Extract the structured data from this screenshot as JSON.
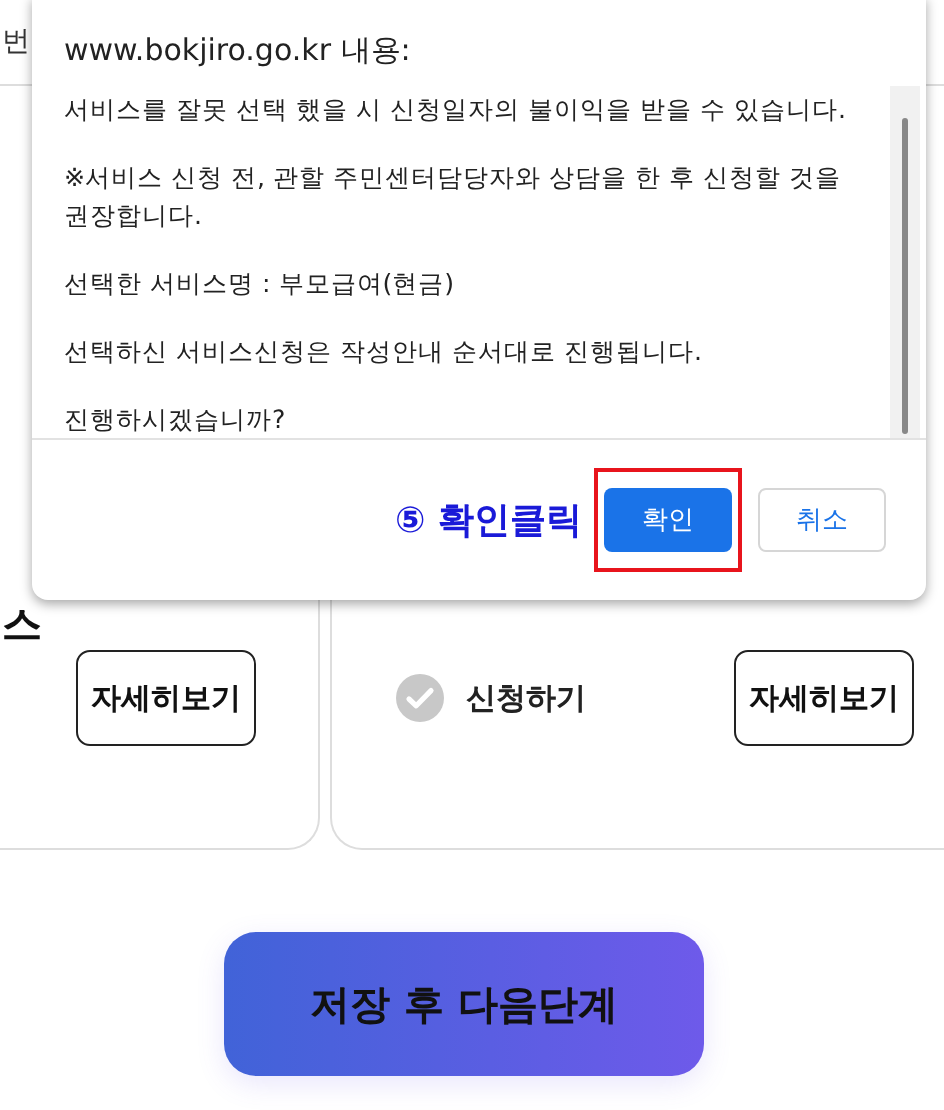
{
  "page_header": {
    "text": "번"
  },
  "cards": [
    {
      "title_fragment": "스",
      "detail_button": "자세히보기"
    },
    {
      "apply": {
        "label": "신청하기",
        "checked": false
      },
      "detail_button": "자세히보기"
    }
  ],
  "next_button": "저장 후 다음단계",
  "dialog": {
    "title": "www.bokjiro.go.kr 내용:",
    "messages": [
      "서비스를 잘못 선택 했을 시 신청일자의 불이익을 받을 수 있습니다.",
      "※서비스 신청 전, 관할 주민센터담당자와 상담을 한 후 신청할 것을 권장합니다.",
      "선택한 서비스명 : 부모급여(현금)",
      "선택하신 서비스신청은 작성안내 순서대로 진행됩니다.",
      "진행하시겠습니까?"
    ],
    "annotation": "⑤ 확인클릭",
    "buttons": [
      {
        "label": "확인",
        "primary": true,
        "highlighted": true
      },
      {
        "label": "취소",
        "primary": false,
        "highlighted": false
      }
    ]
  }
}
